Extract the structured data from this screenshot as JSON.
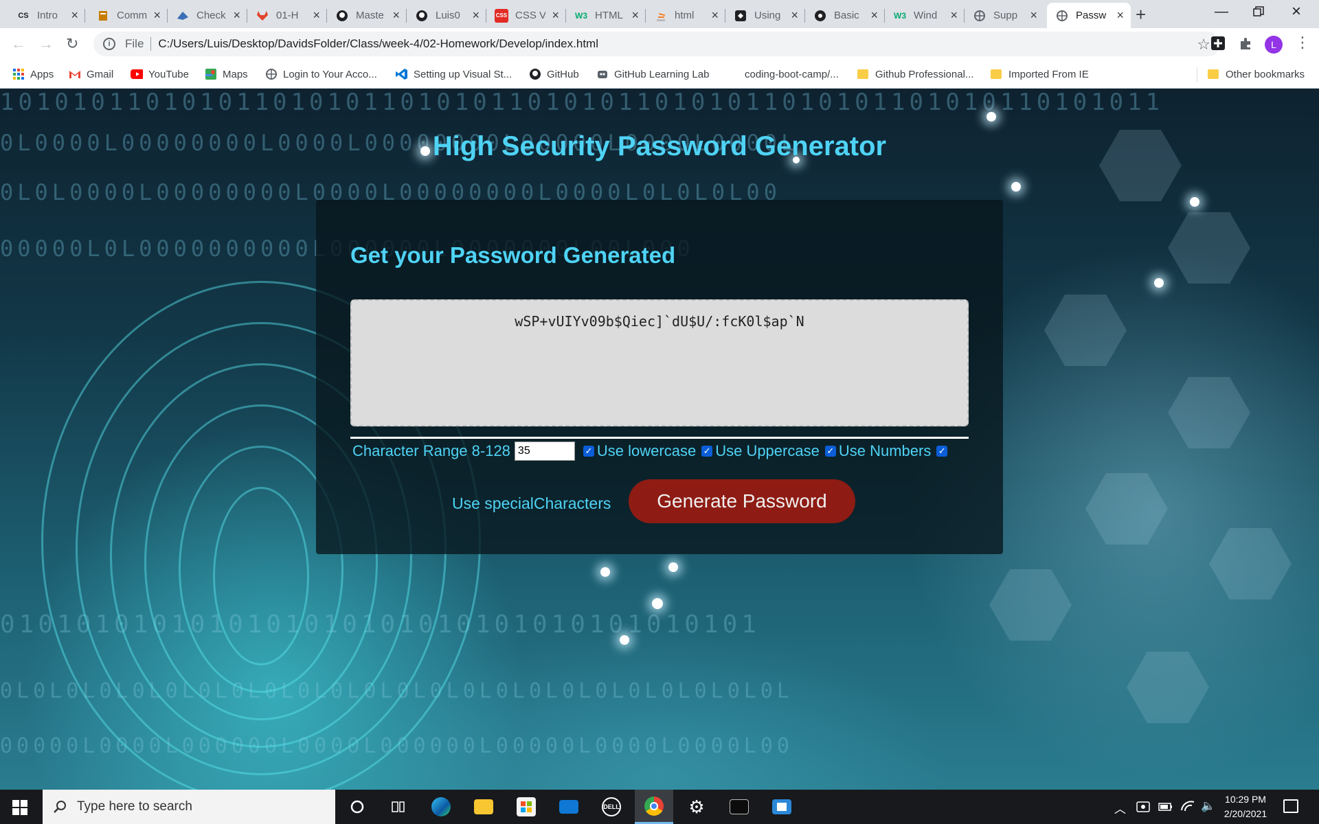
{
  "tabs": [
    {
      "title": "Intro",
      "icon": "cs-icon",
      "icon_text": "CS",
      "color": "#202124"
    },
    {
      "title": "Comm",
      "icon": "ruler-icon",
      "icon_text": "",
      "color": "#c77d00"
    },
    {
      "title": "Check",
      "icon": "bird-icon",
      "icon_text": "",
      "color": "#3b6fb6"
    },
    {
      "title": "01-H",
      "icon": "gitlab-icon",
      "icon_text": "",
      "color": "#e24329"
    },
    {
      "title": "Maste",
      "icon": "github-icon",
      "icon_text": "",
      "color": "#202124"
    },
    {
      "title": "Luis0",
      "icon": "github-icon",
      "icon_text": "",
      "color": "#202124"
    },
    {
      "title": "CSS V",
      "icon": "css-icon",
      "icon_text": "CSS",
      "color": "#e22b25"
    },
    {
      "title": "HTML",
      "icon": "w3schools-icon",
      "icon_text": "W3",
      "color": "#04aa6d"
    },
    {
      "title": "html",
      "icon": "stackoverflow-icon",
      "icon_text": "",
      "color": "#f48024"
    },
    {
      "title": "Using",
      "icon": "codepen-icon",
      "icon_text": "",
      "color": "#202124"
    },
    {
      "title": "Basic",
      "icon": "gear-logo-icon",
      "icon_text": "",
      "color": "#202124"
    },
    {
      "title": "Wind",
      "icon": "w3schools-icon",
      "icon_text": "W3",
      "color": "#04aa6d"
    },
    {
      "title": "Supp",
      "icon": "globe-icon",
      "icon_text": "",
      "color": "#5f6368"
    },
    {
      "title": "Passw",
      "icon": "globe-icon",
      "icon_text": "",
      "color": "#5f6368"
    }
  ],
  "address": {
    "scheme": "File",
    "url": "C:/Users/Luis/Desktop/DavidsFolder/Class/week-4/02-Homework/Develop/index.html"
  },
  "profile_initial": "L",
  "bookmarks": [
    {
      "label": "Apps",
      "icon": "apps-grid-icon"
    },
    {
      "label": "Gmail",
      "icon": "gmail-icon"
    },
    {
      "label": "YouTube",
      "icon": "youtube-icon"
    },
    {
      "label": "Maps",
      "icon": "maps-icon"
    },
    {
      "label": "Login to Your Acco...",
      "icon": "globe-icon"
    },
    {
      "label": "Setting up Visual St...",
      "icon": "vscode-icon"
    },
    {
      "label": "GitHub",
      "icon": "github-icon"
    },
    {
      "label": "GitHub Learning Lab",
      "icon": "learning-lab-icon"
    },
    {
      "label": "coding-boot-camp/...",
      "icon": "page-icon"
    },
    {
      "label": "Github Professional...",
      "icon": "folder-icon"
    },
    {
      "label": "Imported From IE",
      "icon": "folder-icon"
    },
    {
      "label": "Other bookmarks",
      "icon": "folder-icon"
    }
  ],
  "page": {
    "title": "High Security Password Generator",
    "card_title": "Get your Password Generated",
    "password": "wSP+vUIYv09b$Qiec]`dU$U/:fcK0l$ap`N",
    "range_label": "Character Range 8-128",
    "range_value": "35",
    "lowercase_label": "Use lowercase",
    "uppercase_label": "Use Uppercase",
    "numbers_label": "Use Numbers",
    "special_label": "Use specialCharacters",
    "generate_button": "Generate Password",
    "checkboxes": {
      "lowercase": true,
      "uppercase": true,
      "numbers": true,
      "special": true
    }
  },
  "taskbar": {
    "search_placeholder": "Type here to search",
    "time": "10:29 PM",
    "date": "2/20/2021"
  },
  "colors": {
    "accent_text": "#4fd3f5",
    "generate_button": "#8e1c14",
    "card_background": "rgba(8,22,28,0.78)"
  }
}
